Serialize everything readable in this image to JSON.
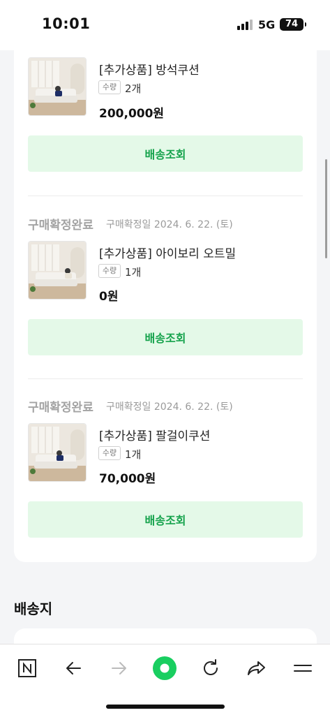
{
  "status_bar": {
    "time": "10:01",
    "network": "5G",
    "battery": "74"
  },
  "orders": [
    {
      "status": "",
      "date": "",
      "product": "[추가상품] 방석쿠션",
      "qty_label": "수량",
      "qty": "2개",
      "price": "200,000원",
      "button": "배송조회"
    },
    {
      "status": "구매확정완료",
      "date": "구매확정일 2024. 6. 22. (토)",
      "product": "[추가상품] 아이보리 오트밀",
      "qty_label": "수량",
      "qty": "1개",
      "price": "0원",
      "button": "배송조회"
    },
    {
      "status": "구매확정완료",
      "date": "구매확정일 2024. 6. 22. (토)",
      "product": "[추가상품] 팔걸이쿠션",
      "qty_label": "수량",
      "qty": "1개",
      "price": "70,000원",
      "button": "배송조회"
    }
  ],
  "shipping_section": {
    "title": "배송지"
  },
  "bottom_nav": {
    "icons": [
      "naver-n-icon",
      "back-arrow-icon",
      "forward-arrow-icon",
      "green-circle-home-icon",
      "refresh-icon",
      "share-icon",
      "menu-icon"
    ]
  },
  "colors": {
    "accent_green": "#14a24b",
    "button_bg": "#e4f9e8",
    "muted_text": "#a3a3a3"
  }
}
